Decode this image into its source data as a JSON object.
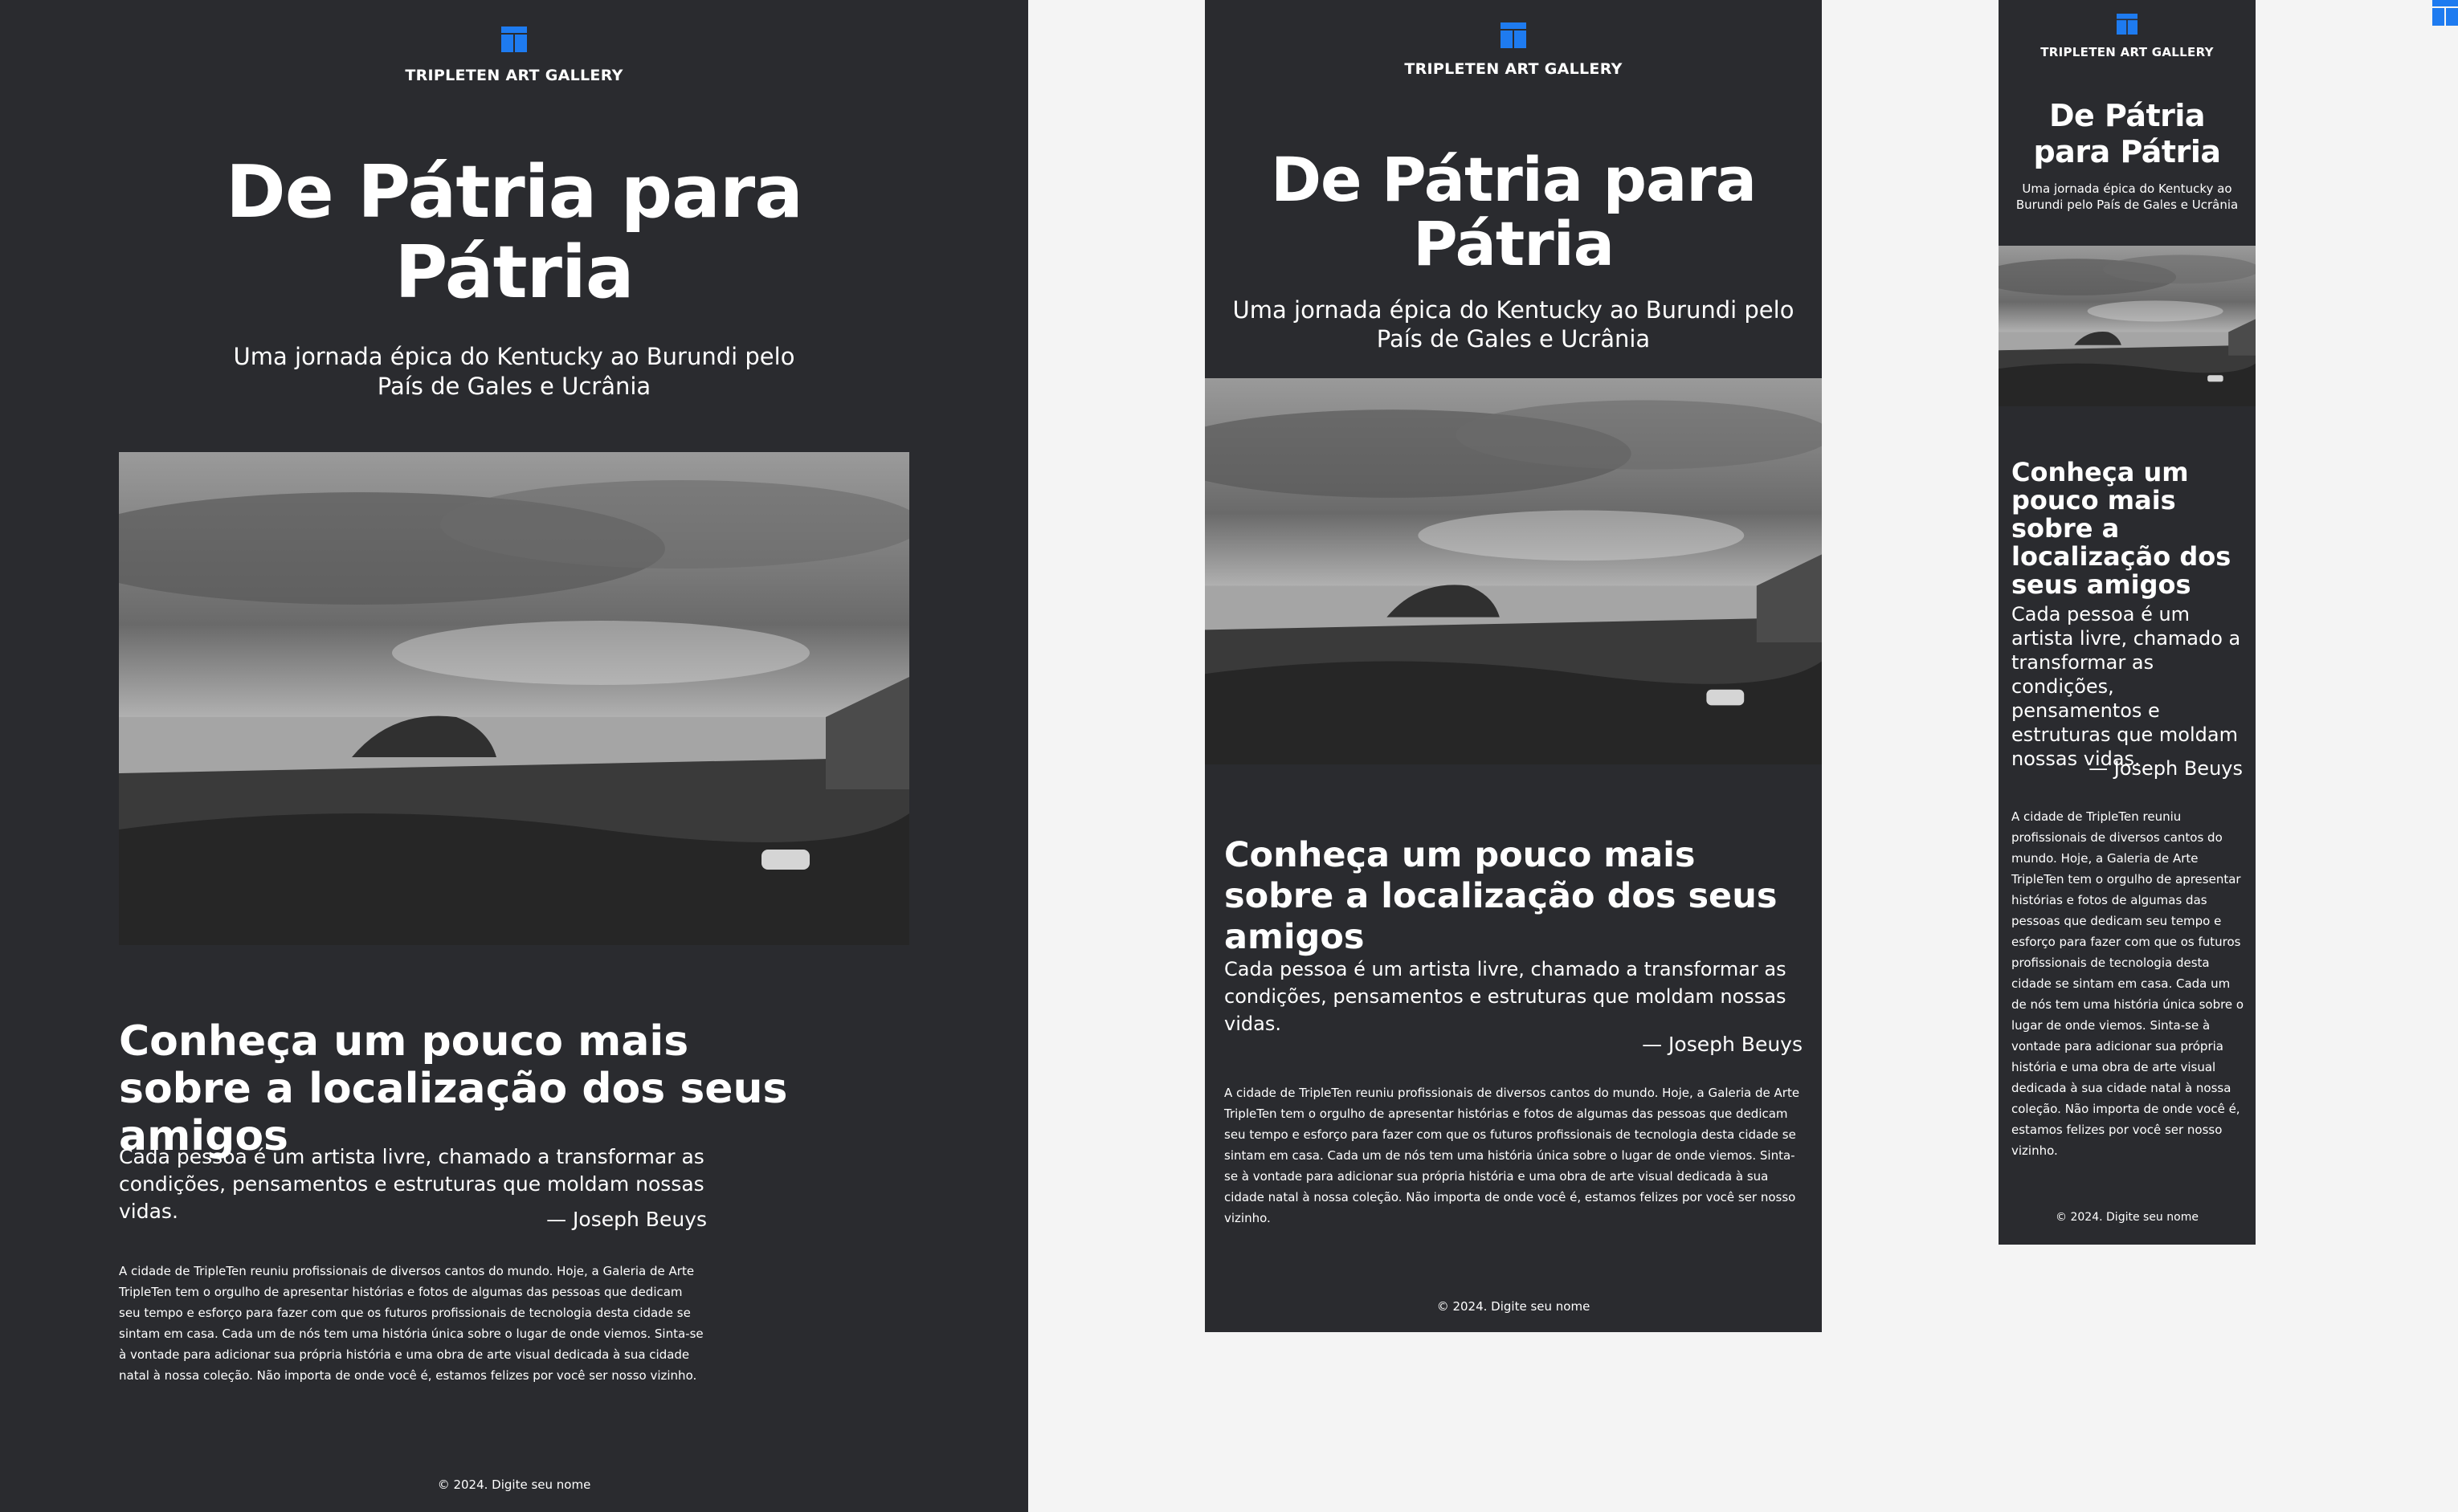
{
  "brand": "TRIPLETEN ART GALLERY",
  "hero": {
    "title": "De Pátria para Pátria",
    "subtitle": "Uma jornada épica do Kentucky ao Burundi pelo País de Gales e Ucrânia"
  },
  "section": {
    "heading": "Conheça um pouco mais sobre a localização dos seus amigos",
    "quote": "Cada pessoa é um artista livre, chamado a transformar as condições, pensamentos e estruturas que moldam nossas vidas.",
    "quote_author": "— Joseph Beuys",
    "body": "A cidade de TripleTen reuniu profissionais de diversos cantos do mundo. Hoje, a Galeria de Arte TripleTen tem o orgulho de apresentar histórias e fotos de algumas das pessoas que dedicam seu tempo e esforço para fazer com que os futuros profissionais de tecnologia desta cidade se sintam em casa. Cada um de nós tem uma história única sobre o lugar de onde viemos. Sinta-se à vontade para adicionar sua própria história e uma obra de arte visual dedicada à sua cidade natal à nossa coleção. Não importa de onde você é, estamos felizes por você ser nosso vizinho."
  },
  "footer": {
    "text": "© 2024. Digite seu nome"
  },
  "colors": {
    "panel_bg": "#2a2b2f",
    "page_bg": "#f4f4f4",
    "accent": "#1e7bf0",
    "text": "#ffffff"
  },
  "icons": {
    "logo": "gallery-grid-icon",
    "corner": "gallery-grid-icon"
  },
  "images": {
    "hero_photo": "Black-and-white coastal town with castle hill under cloudy sky"
  }
}
